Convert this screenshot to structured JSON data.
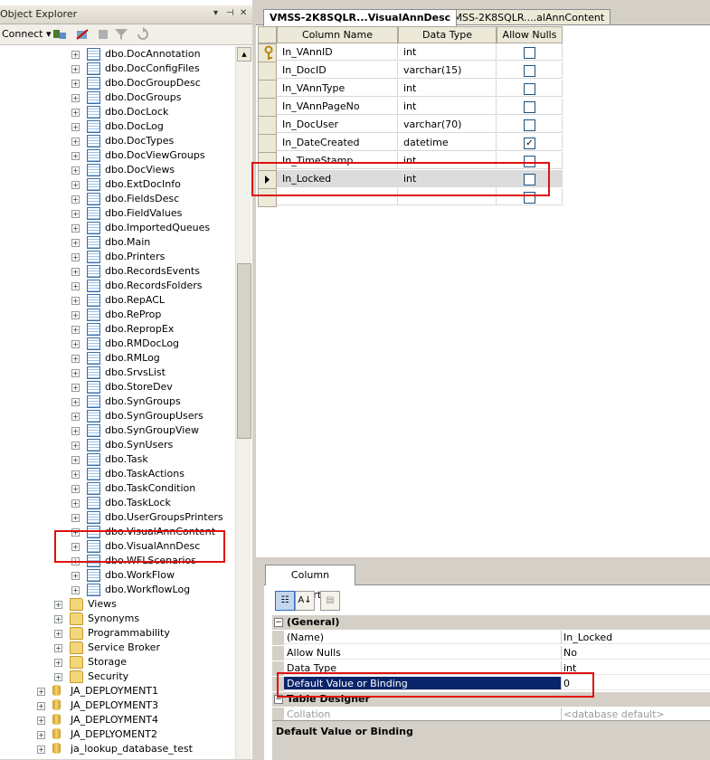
{
  "object_explorer": {
    "title": "Object Explorer",
    "connect_label": "Connect",
    "toolbar_icons": [
      "connect-object-explorer-icon",
      "disconnect-icon",
      "stop-icon",
      "filter-icon",
      "refresh-icon"
    ],
    "tables": [
      "dbo.DocAnnotation",
      "dbo.DocConfigFiles",
      "dbo.DocGroupDesc",
      "dbo.DocGroups",
      "dbo.DocLock",
      "dbo.DocLog",
      "dbo.DocTypes",
      "dbo.DocViewGroups",
      "dbo.DocViews",
      "dbo.ExtDocInfo",
      "dbo.FieldsDesc",
      "dbo.FieldValues",
      "dbo.ImportedQueues",
      "dbo.Main",
      "dbo.Printers",
      "dbo.RecordsEvents",
      "dbo.RecordsFolders",
      "dbo.RepACL",
      "dbo.ReProp",
      "dbo.RepropEx",
      "dbo.RMDocLog",
      "dbo.RMLog",
      "dbo.SrvsList",
      "dbo.StoreDev",
      "dbo.SynGroups",
      "dbo.SynGroupUsers",
      "dbo.SynGroupView",
      "dbo.SynUsers",
      "dbo.Task",
      "dbo.TaskActions",
      "dbo.TaskCondition",
      "dbo.TaskLock",
      "dbo.UserGroupsPrinters",
      "dbo.VisualAnnContent",
      "dbo.VisualAnnDesc",
      "dbo.WFLScenarios",
      "dbo.WorkFlow",
      "dbo.WorkflowLog"
    ],
    "folders": [
      "Views",
      "Synonyms",
      "Programmability",
      "Service Broker",
      "Storage",
      "Security"
    ],
    "databases": [
      "JA_DEPLOYMENT1",
      "JA_DEPLOYMENT3",
      "JA_DEPLOYMENT4",
      "JA_DEPLYOMENT2",
      "ja_lookup_database_test"
    ]
  },
  "tabs": [
    {
      "label": "VMSS-2K8SQLR...VisualAnnDesc",
      "active": true
    },
    {
      "label": "VMSS-2K8SQLR....alAnnContent",
      "active": false
    }
  ],
  "grid": {
    "headers": [
      "Column Name",
      "Data Type",
      "Allow Nulls"
    ],
    "rows": [
      {
        "name": "In_VAnnID",
        "type": "int",
        "nulls": false,
        "key": true
      },
      {
        "name": "In_DocID",
        "type": "varchar(15)",
        "nulls": false
      },
      {
        "name": "In_VAnnType",
        "type": "int",
        "nulls": false
      },
      {
        "name": "In_VAnnPageNo",
        "type": "int",
        "nulls": false
      },
      {
        "name": "In_DocUser",
        "type": "varchar(70)",
        "nulls": false
      },
      {
        "name": "In_DateCreated",
        "type": "datetime",
        "nulls": true
      },
      {
        "name": "In_TimeStamp",
        "type": "int",
        "nulls": false
      },
      {
        "name": "In_Locked",
        "type": "int",
        "nulls": false,
        "active": true
      },
      {
        "name": "",
        "type": "",
        "nulls": false
      }
    ]
  },
  "column_properties": {
    "tab_label": "Column Properties",
    "categories": [
      {
        "label": "(General)",
        "rows": [
          {
            "key": "(Name)",
            "value": "In_Locked"
          },
          {
            "key": "Allow Nulls",
            "value": "No"
          },
          {
            "key": "Data Type",
            "value": "int"
          },
          {
            "key": "Default Value or Binding",
            "value": "0",
            "selected": true
          }
        ]
      },
      {
        "label": "Table Designer",
        "rows": [
          {
            "key": "Collation",
            "value": "<database default>",
            "dim": true
          }
        ]
      }
    ],
    "description_title": "Default Value or Binding"
  },
  "colors": {
    "selection": "#0a246a",
    "highlight_box": "#e01010",
    "chrome": "#d4d0c8"
  }
}
